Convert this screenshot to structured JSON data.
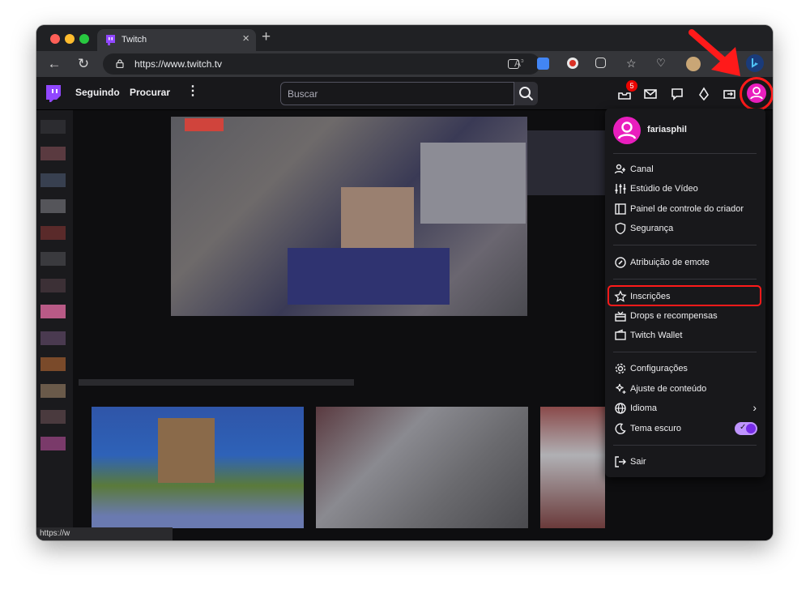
{
  "browser": {
    "tab_title": "Twitch",
    "url": "https://www.twitch.tv",
    "reader_label": "A",
    "status_url": "https://w"
  },
  "header": {
    "nav_following": "Seguindo",
    "nav_browse": "Procurar",
    "more_label": "⋮",
    "search_placeholder": "Buscar",
    "notifications_count": "5"
  },
  "menu": {
    "username": "fariasphil",
    "groups": [
      [
        {
          "label": "Canal",
          "icon": "channel-icon"
        },
        {
          "label": "Estúdio de Vídeo",
          "icon": "video-studio-icon"
        },
        {
          "label": "Painel de controle do criador",
          "icon": "dashboard-icon"
        },
        {
          "label": "Segurança",
          "icon": "shield-icon"
        }
      ],
      [
        {
          "label": "Atribuição de emote",
          "icon": "emote-icon"
        }
      ],
      [
        {
          "label": "Inscrições",
          "icon": "star-icon"
        },
        {
          "label": "Drops e recompensas",
          "icon": "gift-icon"
        },
        {
          "label": "Twitch Wallet",
          "icon": "wallet-icon"
        }
      ],
      [
        {
          "label": "Configurações",
          "icon": "gear-icon"
        },
        {
          "label": "Ajuste de conteúdo",
          "icon": "sparkle-icon"
        },
        {
          "label": "Idioma",
          "icon": "globe-icon"
        },
        {
          "label": "Tema escuro",
          "icon": "moon-icon"
        }
      ],
      [
        {
          "label": "Sair",
          "icon": "logout-icon"
        }
      ]
    ],
    "dark_theme_enabled": true
  },
  "colors": {
    "twitch_purple": "#9147ff",
    "avatar_pink": "#e91ebe",
    "annotation_red": "#ff1a1a"
  }
}
